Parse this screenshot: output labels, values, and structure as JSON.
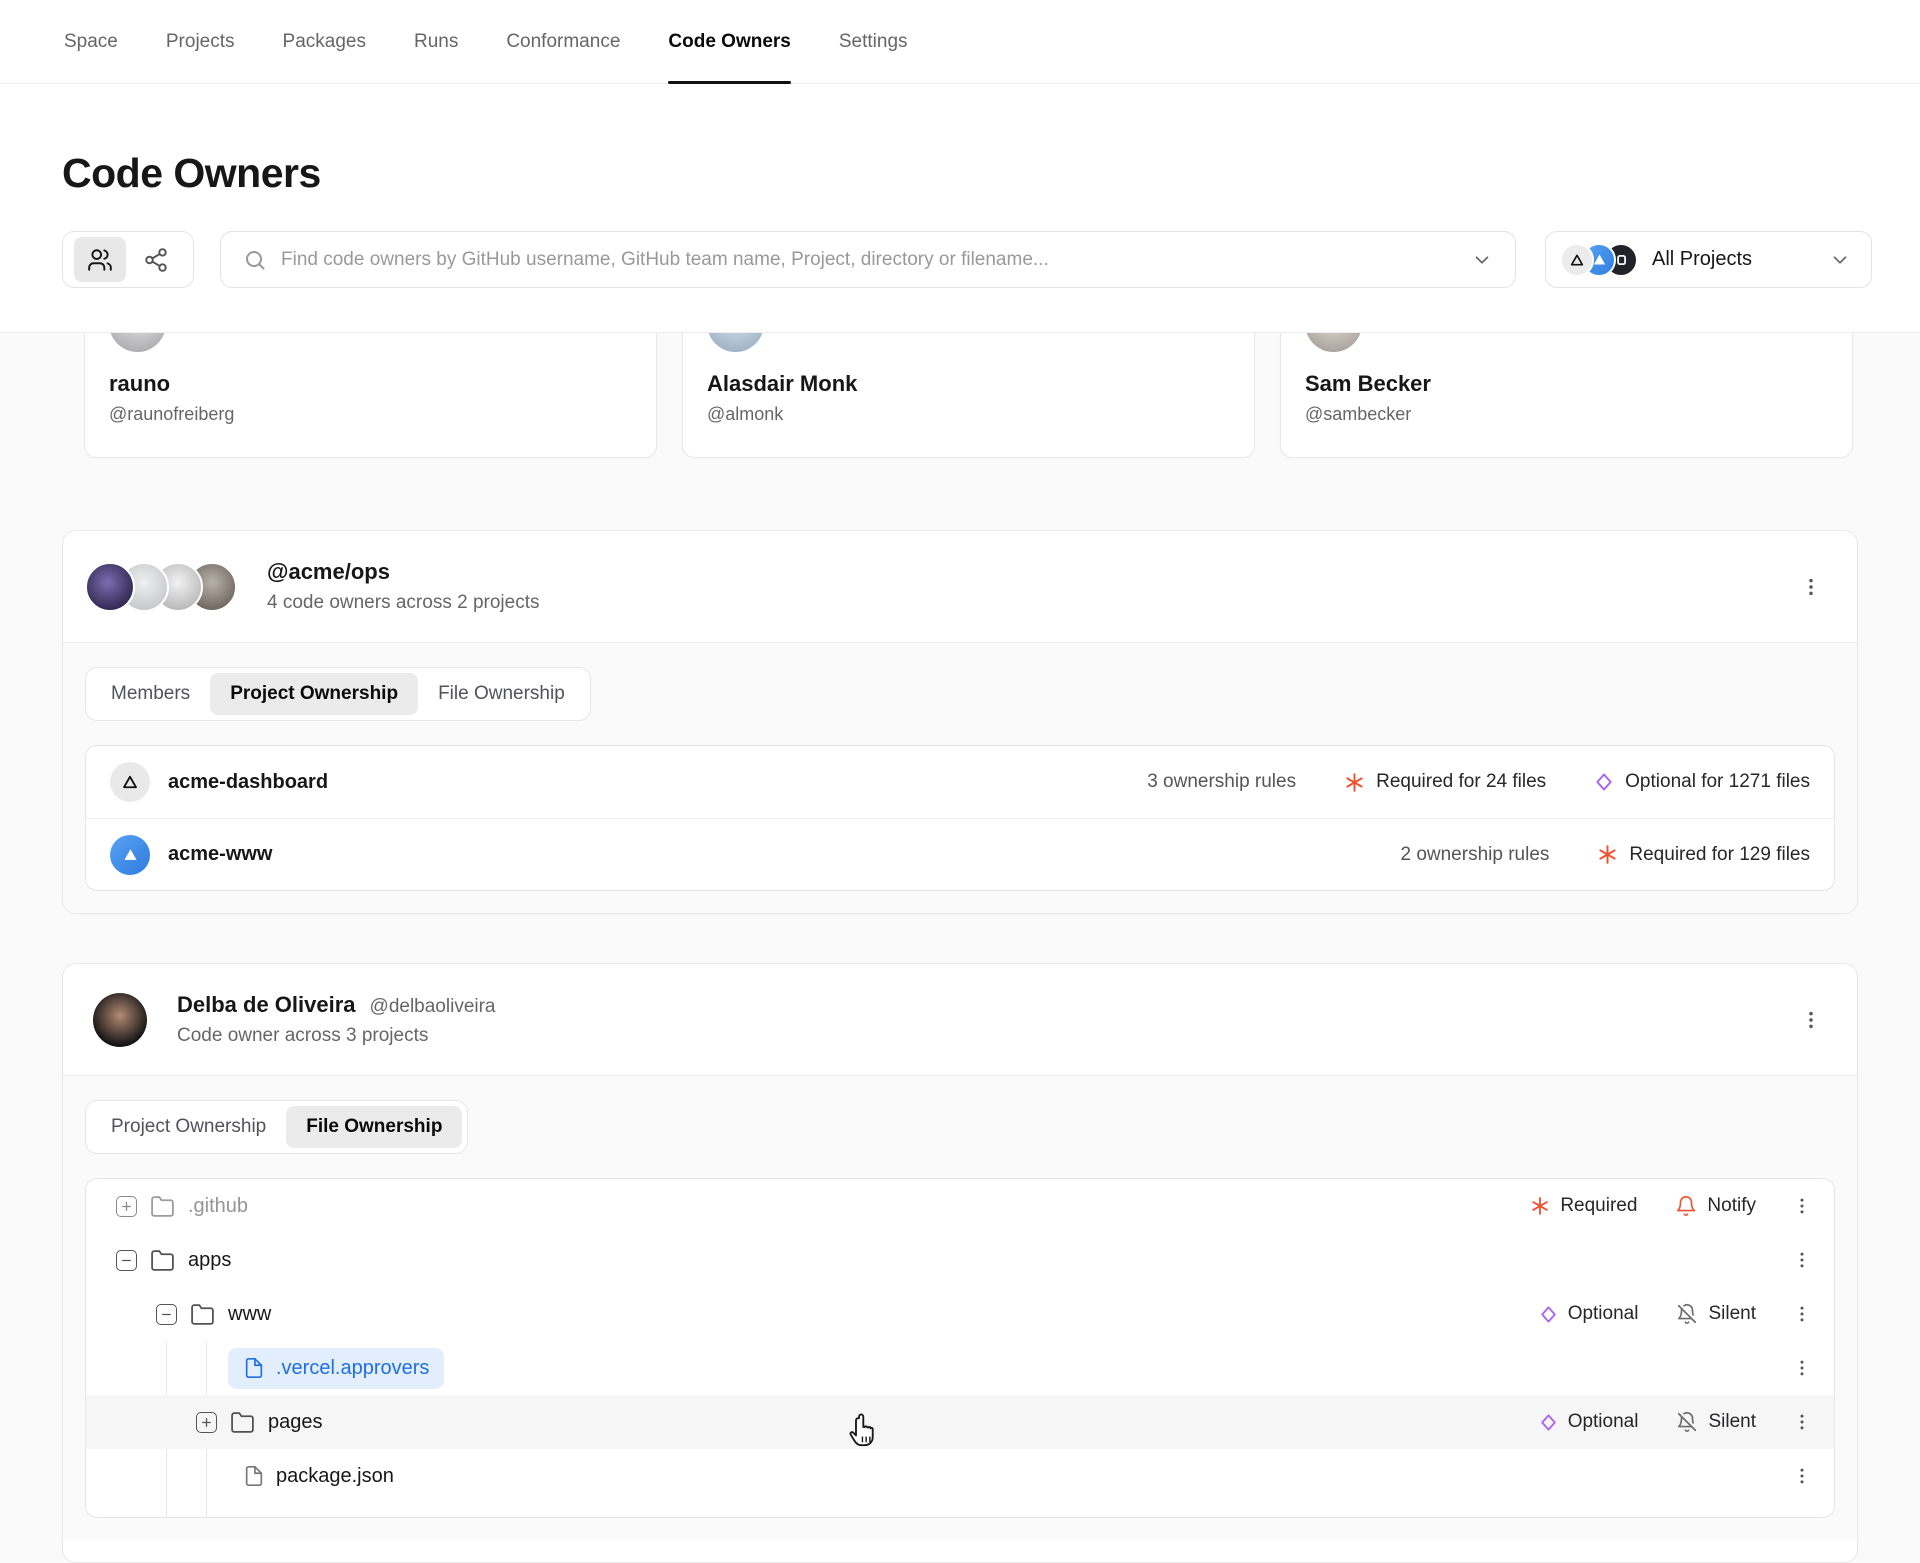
{
  "nav": {
    "items": [
      {
        "label": "Space"
      },
      {
        "label": "Projects"
      },
      {
        "label": "Packages"
      },
      {
        "label": "Runs"
      },
      {
        "label": "Conformance"
      },
      {
        "label": "Code Owners"
      },
      {
        "label": "Settings"
      }
    ]
  },
  "page": {
    "title": "Code Owners"
  },
  "toolbar": {
    "search_placeholder": "Find code owners by GitHub username, GitHub team name, Project, directory or filename...",
    "project_filter_label": "All Projects"
  },
  "owner_cards": [
    {
      "name": "rauno",
      "handle": "@raunofreiberg"
    },
    {
      "name": "Alasdair Monk",
      "handle": "@almonk"
    },
    {
      "name": "Sam Becker",
      "handle": "@sambecker"
    }
  ],
  "team_card": {
    "title": "@acme/ops",
    "subtitle": "4 code owners across 2 projects",
    "tabs": [
      {
        "label": "Members"
      },
      {
        "label": "Project Ownership"
      },
      {
        "label": "File Ownership"
      }
    ],
    "projects": [
      {
        "name": "acme-dashboard",
        "rules": "3 ownership rules",
        "required": "Required for 24 files",
        "optional": "Optional for 1271 files"
      },
      {
        "name": "acme-www",
        "rules": "2 ownership rules",
        "required": "Required for 129 files"
      }
    ]
  },
  "person_card": {
    "name": "Delba de Oliveira",
    "handle": "@delbaoliveira",
    "subtitle": "Code owner across 3 projects",
    "tabs": [
      {
        "label": "Project Ownership"
      },
      {
        "label": "File Ownership"
      }
    ],
    "tree": [
      {
        "label": ".github"
      },
      {
        "label": "apps"
      },
      {
        "label": "www"
      },
      {
        "label": ".vercel.approvers"
      },
      {
        "label": "pages"
      },
      {
        "label": "package.json"
      }
    ],
    "badge_labels": {
      "required": "Required",
      "notify": "Notify",
      "optional": "Optional",
      "silent": "Silent"
    }
  },
  "colors": {
    "accent_blue": "#0070f3",
    "required_red": "#f0502f",
    "optional_purple": "#a661f5",
    "page_bg": "#fafafa"
  }
}
